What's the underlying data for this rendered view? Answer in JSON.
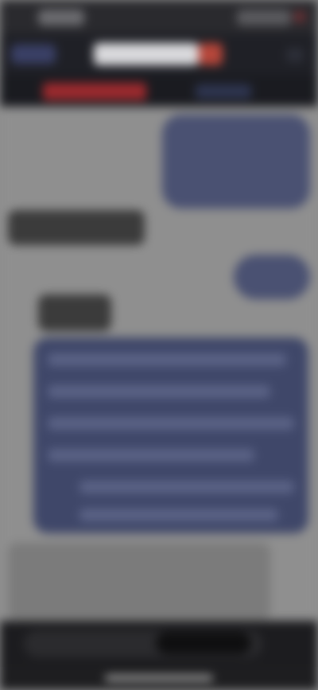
{
  "status_bar": {
    "time": "",
    "icons": [
      "signal-icon",
      "wifi-icon",
      "battery-icon"
    ]
  },
  "header": {
    "logo_text": "",
    "menu_icon": "menu-icon",
    "accent_color": "#b5463a"
  },
  "nav": {
    "active_tab": "",
    "second_tab": ""
  },
  "messages": [
    {
      "id": "m1",
      "side": "outgoing",
      "text": ""
    },
    {
      "id": "m2",
      "side": "incoming",
      "text": ""
    },
    {
      "id": "m3",
      "side": "outgoing",
      "text": ""
    },
    {
      "id": "m4",
      "side": "incoming",
      "text": ""
    }
  ],
  "panel": {
    "text": ""
  },
  "quote": {
    "text": ""
  },
  "composer": {
    "placeholder": "",
    "send_label": ""
  },
  "colors": {
    "bubble_outgoing": "#4a5172",
    "background": "#8f8f8f",
    "chrome": "#1f2026"
  }
}
